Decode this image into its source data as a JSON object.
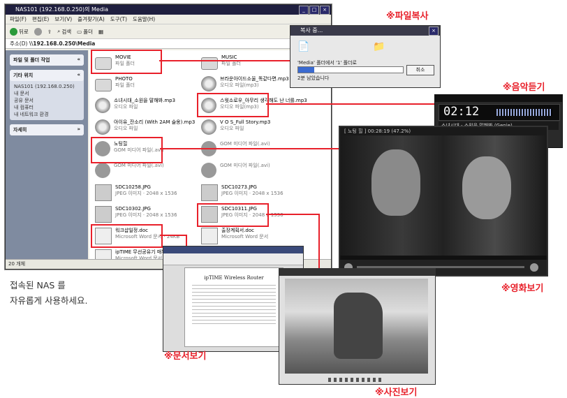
{
  "explorer": {
    "title": "NAS101 (192.168.0.250)의 Media",
    "menu": [
      "파일(F)",
      "편집(E)",
      "보기(V)",
      "즐겨찾기(A)",
      "도구(T)",
      "도움말(H)"
    ],
    "toolbar": {
      "back": "뒤로",
      "search": "검색",
      "folders": "폴더"
    },
    "address_label": "주소(D)",
    "address": "\\\\192.168.0.250\\Media",
    "panels": [
      {
        "title": "파일 및 폴더 작업"
      },
      {
        "title": "기타 위치",
        "items": [
          "NAS101 (192.168.0.250)",
          "내 문서",
          "공유 문서",
          "내 컴퓨터",
          "내 네트워크 환경"
        ]
      },
      {
        "title": "자세히"
      }
    ],
    "files": [
      {
        "name": "MOVIE",
        "sub": "파일 폴더",
        "type": "folder"
      },
      {
        "name": "MUSIC",
        "sub": "파일 폴더",
        "type": "folder"
      },
      {
        "name": "PHOTO",
        "sub": "파일 폴더",
        "type": "folder"
      },
      {
        "name": "브라운아이드소울_똑같다면.mp3",
        "sub": "오디오 파일(mp3)",
        "type": "mp3"
      },
      {
        "name": "소녀시대_소원을 말해봐.mp3",
        "sub": "오디오 파일",
        "type": "mp3"
      },
      {
        "name": "스윗소로우_아무리 생각해도 난 너를.mp3",
        "sub": "오디오 파일(mp3)",
        "type": "mp3"
      },
      {
        "name": "아이유_잔소리 (With 2AM 슬옹).mp3",
        "sub": "오디오 파일",
        "type": "mp3"
      },
      {
        "name": "V O S_Full Story.mp3",
        "sub": "오디오 파일",
        "type": "mp3"
      },
      {
        "name": "노팅힐",
        "sub": "GOM 미디어 파일(.avi)",
        "type": "avi"
      },
      {
        "name": "",
        "sub": "GOM 미디어 파일(.avi)",
        "type": "avi"
      },
      {
        "name": "",
        "sub": "GOM 미디어 파일(.avi)",
        "type": "avi"
      },
      {
        "name": "",
        "sub": "GOM 미디어 파일(.avi)",
        "type": "avi"
      },
      {
        "name": "SDC10258.JPG",
        "sub": "JPEG 이미지 · 2048 x 1536",
        "type": "jpg"
      },
      {
        "name": "SDC10273.JPG",
        "sub": "JPEG 이미지 · 2048 x 1536",
        "type": "jpg"
      },
      {
        "name": "SDC10302.JPG",
        "sub": "JPEG 이미지 · 2048 x 1536",
        "type": "jpg"
      },
      {
        "name": "SDC10311.JPG",
        "sub": "JPEG 이미지 · 2048 x 1536",
        "type": "jpg"
      },
      {
        "name": "워크샵일정.doc",
        "sub": "Microsoft Word 문서 · 24KB",
        "type": "doc"
      },
      {
        "name": "출장계획서.doc",
        "sub": "Microsoft Word 문서",
        "type": "doc"
      },
      {
        "name": "ipTIME 무선공유기 매뉴얼.doc",
        "sub": "Microsoft Word 문서",
        "type": "doc"
      }
    ],
    "status": "20 개체"
  },
  "copy_dialog": {
    "title": "복사 중...",
    "text": "'Media' 폴더에서 '1' 폴더로",
    "remaining": "2분 남았습니다",
    "cancel": "취소"
  },
  "player": {
    "time": "02:12",
    "track": "소녀시대 - 소원을 말해봐 (Genie)"
  },
  "movie": {
    "title": "[ 노팅 힐 ]  00:28:19 (47.2%)"
  },
  "doc_viewer": {
    "heading": "ipTIME Wireless Router"
  },
  "captions": {
    "copy": "※파일복사",
    "music": "※음악듣기",
    "movie": "※영화보기",
    "doc": "※문서보기",
    "photo": "※사진보기"
  },
  "description": [
    "접속된 NAS 를",
    "자유롭게 사용하세요."
  ],
  "colors": {
    "accent": "#e8202a"
  }
}
